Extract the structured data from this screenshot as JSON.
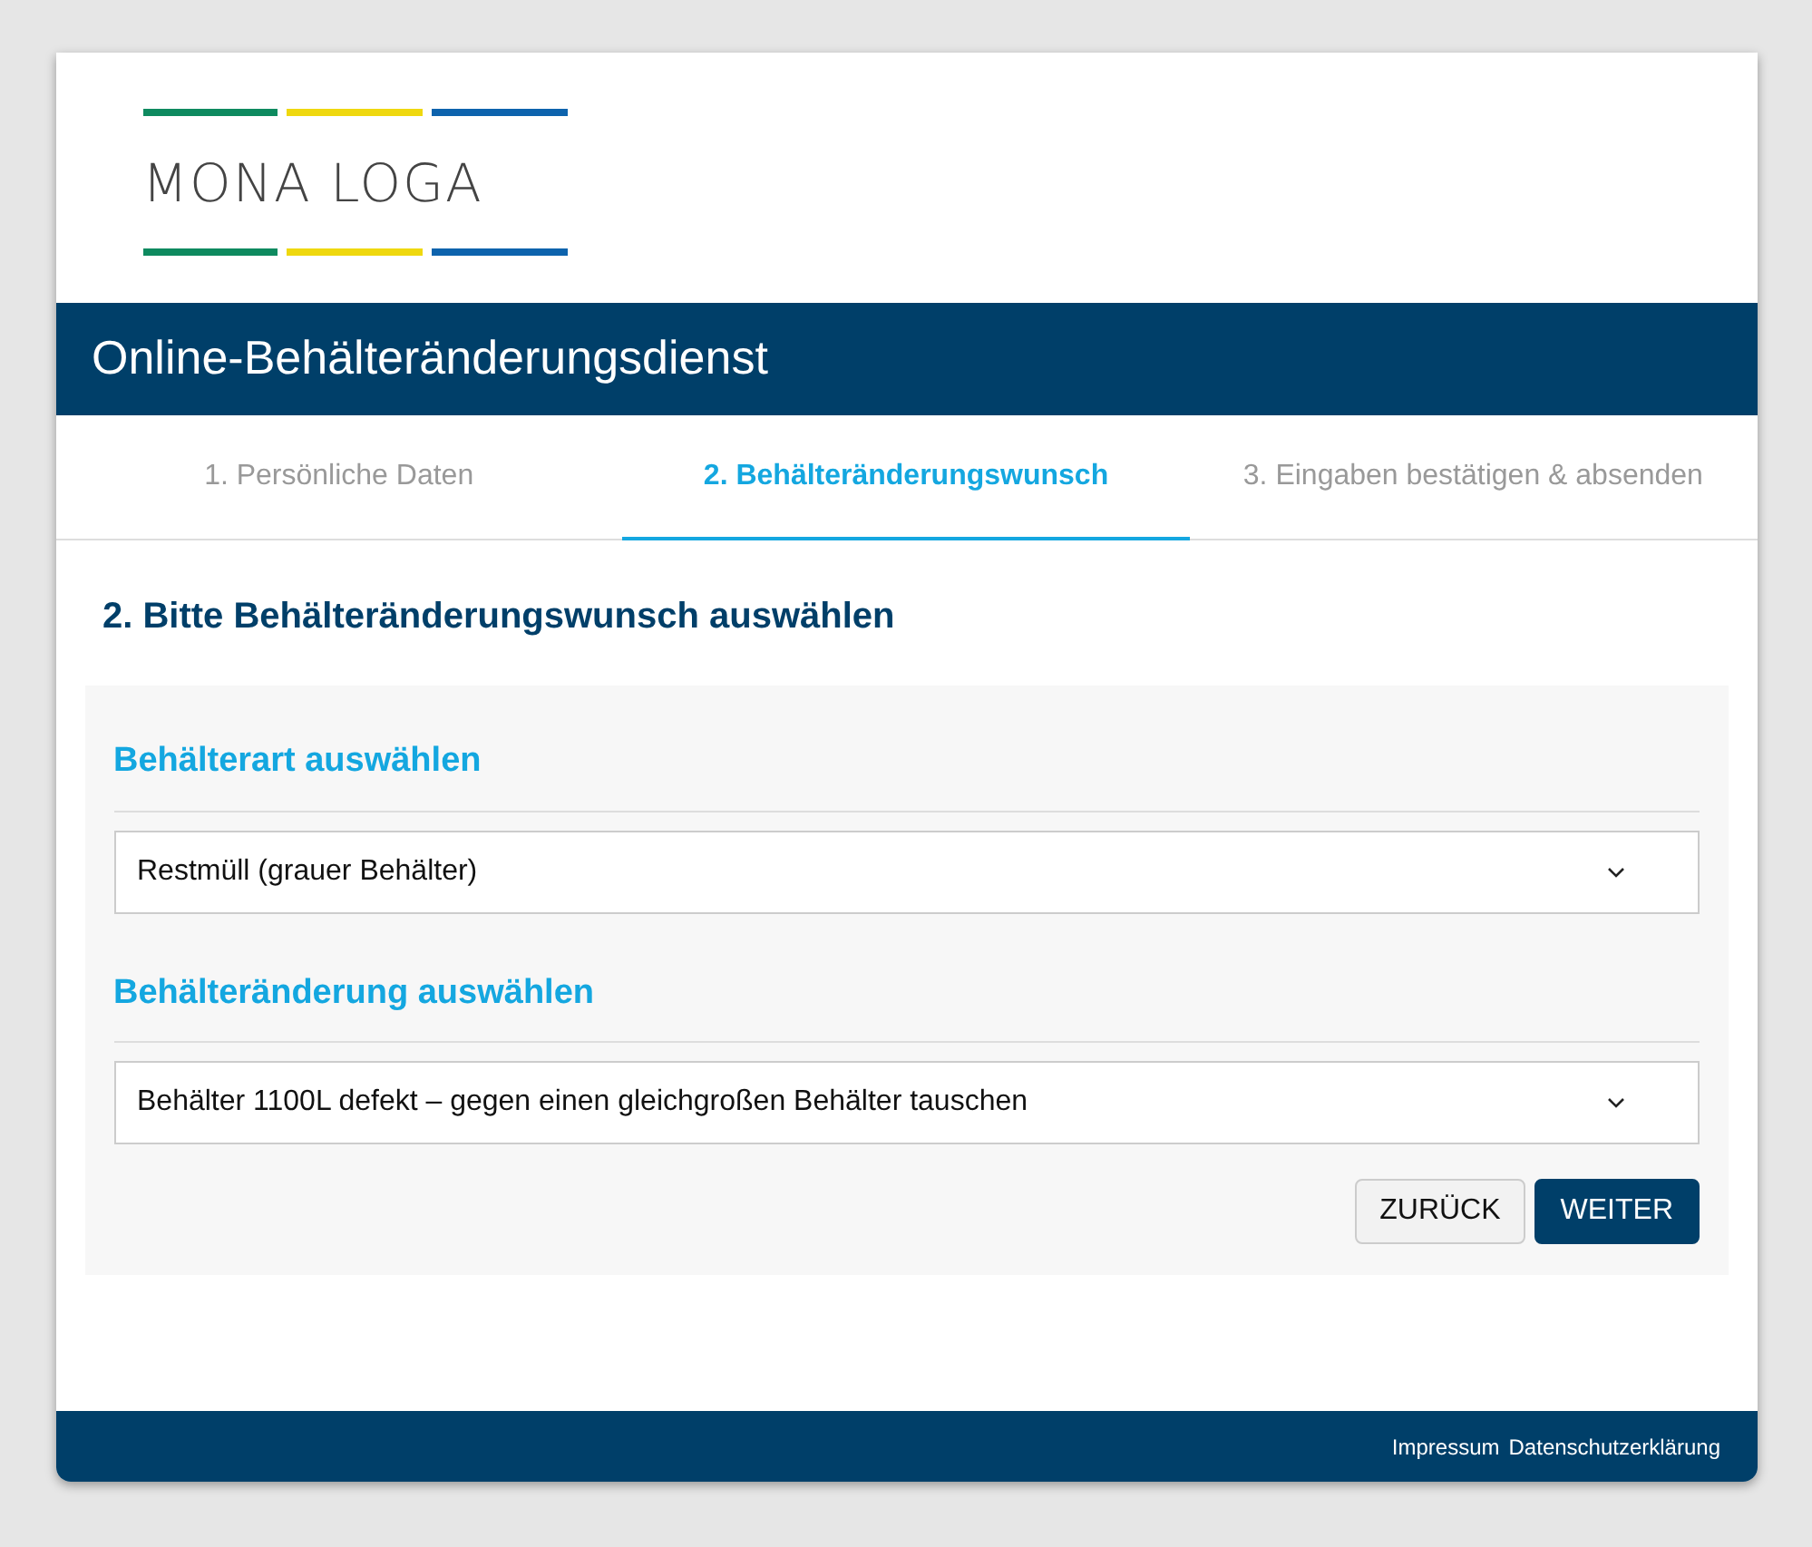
{
  "logo": {
    "text": "MONA LOGA"
  },
  "header": {
    "title": "Online-Behälteränderungsdienst"
  },
  "steps": [
    {
      "label": "1. Persönliche Daten",
      "selected": false
    },
    {
      "label": "2. Behälteränderungswunsch",
      "selected": true
    },
    {
      "label": "3. Eingaben bestätigen & absenden",
      "selected": false
    }
  ],
  "heading": "2. Bitte Behälteränderungswunsch auswählen",
  "sections": [
    {
      "title": "Behälterart auswählen",
      "value": "Restmüll (grauer Behälter)"
    },
    {
      "title": "Behälteränderung auswählen",
      "value": "Behälter 1100L defekt – gegen einen gleichgroßen Behälter tauschen"
    }
  ],
  "buttons": [
    {
      "label": "ZURÜCK",
      "kind": "secondary"
    },
    {
      "label": "WEITER",
      "kind": "primary"
    }
  ],
  "footer": {
    "links": [
      "Impressum",
      "Datenschutzerklärung"
    ]
  }
}
